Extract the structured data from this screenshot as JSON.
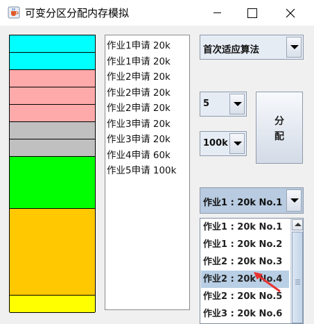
{
  "window": {
    "title": "可变分区分配内存模拟"
  },
  "memory_blocks": [
    {
      "color": "#00ffff",
      "height_units": 1
    },
    {
      "color": "#00ffff",
      "height_units": 1
    },
    {
      "color": "#ffaaaa",
      "height_units": 1
    },
    {
      "color": "#ffaaaa",
      "height_units": 1
    },
    {
      "color": "#ffaaaa",
      "height_units": 1
    },
    {
      "color": "#c0c0c0",
      "height_units": 1
    },
    {
      "color": "#c0c0c0",
      "height_units": 1
    },
    {
      "color": "#00ff00",
      "height_units": 3
    },
    {
      "color": "#ffc800",
      "height_units": 5
    },
    {
      "color": "#ffff00",
      "height_units": 1
    }
  ],
  "requests": [
    "作业1申请 20k",
    "作业1申请 20k",
    "作业2申请 20k",
    "作业2申请 20k",
    "作业2申请 20k",
    "作业3申请 20k",
    "作业3申请 20k",
    "作业4申请 60k",
    "作业5申请 100k"
  ],
  "algorithm_select": {
    "value": "首次适应算法"
  },
  "job_select": {
    "value": "5"
  },
  "size_select": {
    "value": "100k"
  },
  "allocate_button": {
    "line1": "分",
    "line2": "配"
  },
  "block_select": {
    "value": "作业1 : 20k  No.1"
  },
  "block_dropdown": {
    "items": [
      "作业1 : 20k  No.1",
      "作业1 : 20k  No.2",
      "作业2 : 20k  No.3",
      "作业2 : 20k  No.4",
      "作业2 : 20k  No.5",
      "作业3 : 20k  No.6"
    ],
    "selected_index": 3
  }
}
